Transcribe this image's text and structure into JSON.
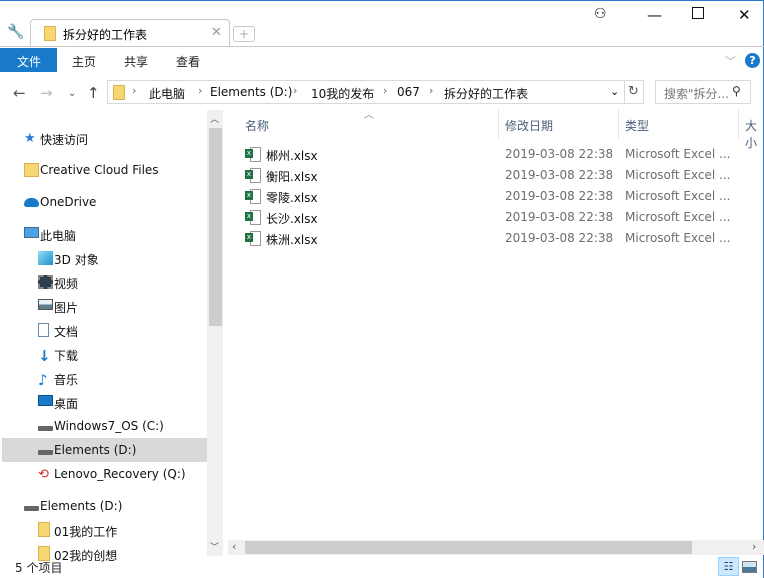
{
  "window": {
    "tab_title": "拆分好的工作表"
  },
  "ribbon": {
    "tabs": [
      {
        "label": "文件"
      },
      {
        "label": "主页"
      },
      {
        "label": "共享"
      },
      {
        "label": "查看"
      }
    ]
  },
  "address": {
    "crumbs": [
      "此电脑",
      "Elements (D:)",
      "10我的发布",
      "067",
      "拆分好的工作表"
    ],
    "search_placeholder": "搜索\"拆分... "
  },
  "nav": {
    "items": [
      {
        "label": "快速访问",
        "icon": "star-icon"
      },
      {
        "label": "Creative Cloud Files",
        "icon": "creative-cloud-icon"
      },
      {
        "label": "OneDrive",
        "icon": "cloud-icon"
      },
      {
        "label": "此电脑",
        "icon": "computer-icon"
      },
      {
        "label": "3D 对象",
        "icon": "cube-icon"
      },
      {
        "label": "视频",
        "icon": "video-icon"
      },
      {
        "label": "图片",
        "icon": "picture-icon"
      },
      {
        "label": "文档",
        "icon": "document-icon"
      },
      {
        "label": "下载",
        "icon": "download-icon"
      },
      {
        "label": "音乐",
        "icon": "music-icon"
      },
      {
        "label": "桌面",
        "icon": "desktop-icon"
      },
      {
        "label": "Windows7_OS (C:)",
        "icon": "drive-icon"
      },
      {
        "label": "Elements (D:)",
        "icon": "drive-icon"
      },
      {
        "label": "Lenovo_Recovery (Q:)",
        "icon": "recovery-drive-icon"
      },
      {
        "label": "Elements (D:)",
        "icon": "drive-icon"
      },
      {
        "label": "01我的工作",
        "icon": "folder-icon"
      },
      {
        "label": "02我的创想",
        "icon": "folder-icon"
      }
    ]
  },
  "columns": {
    "name": "名称",
    "date": "修改日期",
    "type": "类型",
    "size": "大小"
  },
  "files": [
    {
      "name": "郴州.xlsx",
      "date": "2019-03-08 22:38",
      "type": "Microsoft Excel ..."
    },
    {
      "name": "衡阳.xlsx",
      "date": "2019-03-08 22:38",
      "type": "Microsoft Excel ..."
    },
    {
      "name": "零陵.xlsx",
      "date": "2019-03-08 22:38",
      "type": "Microsoft Excel ..."
    },
    {
      "name": "长沙.xlsx",
      "date": "2019-03-08 22:38",
      "type": "Microsoft Excel ..."
    },
    {
      "name": "株洲.xlsx",
      "date": "2019-03-08 22:38",
      "type": "Microsoft Excel ..."
    }
  ],
  "status": {
    "count": "5 个项目"
  },
  "colors": {
    "accent": "#1979ca",
    "selected": "#d9d9d9"
  }
}
